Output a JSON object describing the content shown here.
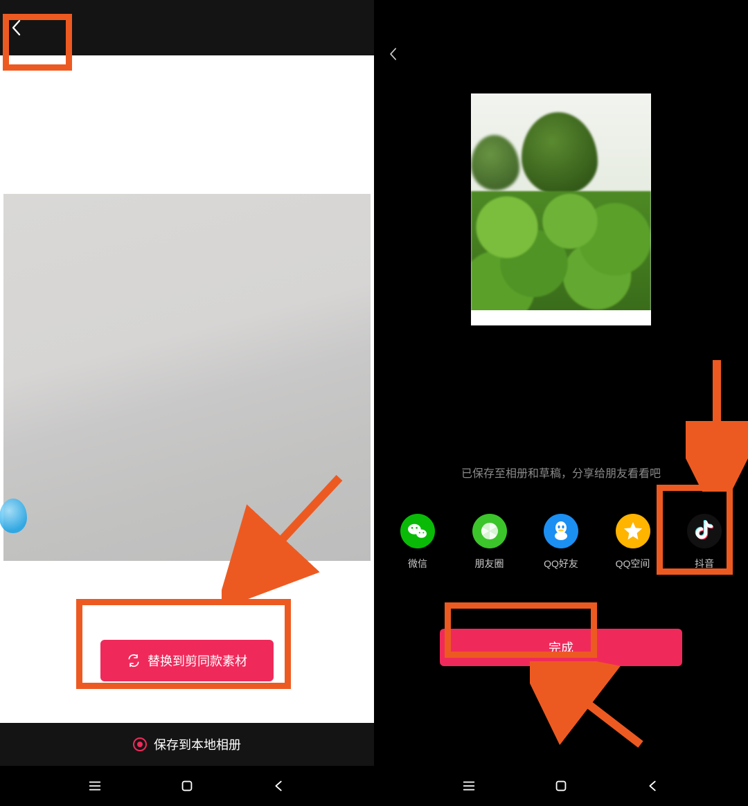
{
  "left": {
    "replace_button": "替换到剪同款素材",
    "save_label": "保存到本地相册"
  },
  "right": {
    "saved_hint": "已保存至相册和草稿，分享给朋友看看吧",
    "share": {
      "wechat": "微信",
      "moments": "朋友圈",
      "qq": "QQ好友",
      "qzone": "QQ空间",
      "douyin": "抖音"
    },
    "done_button": "完成"
  }
}
